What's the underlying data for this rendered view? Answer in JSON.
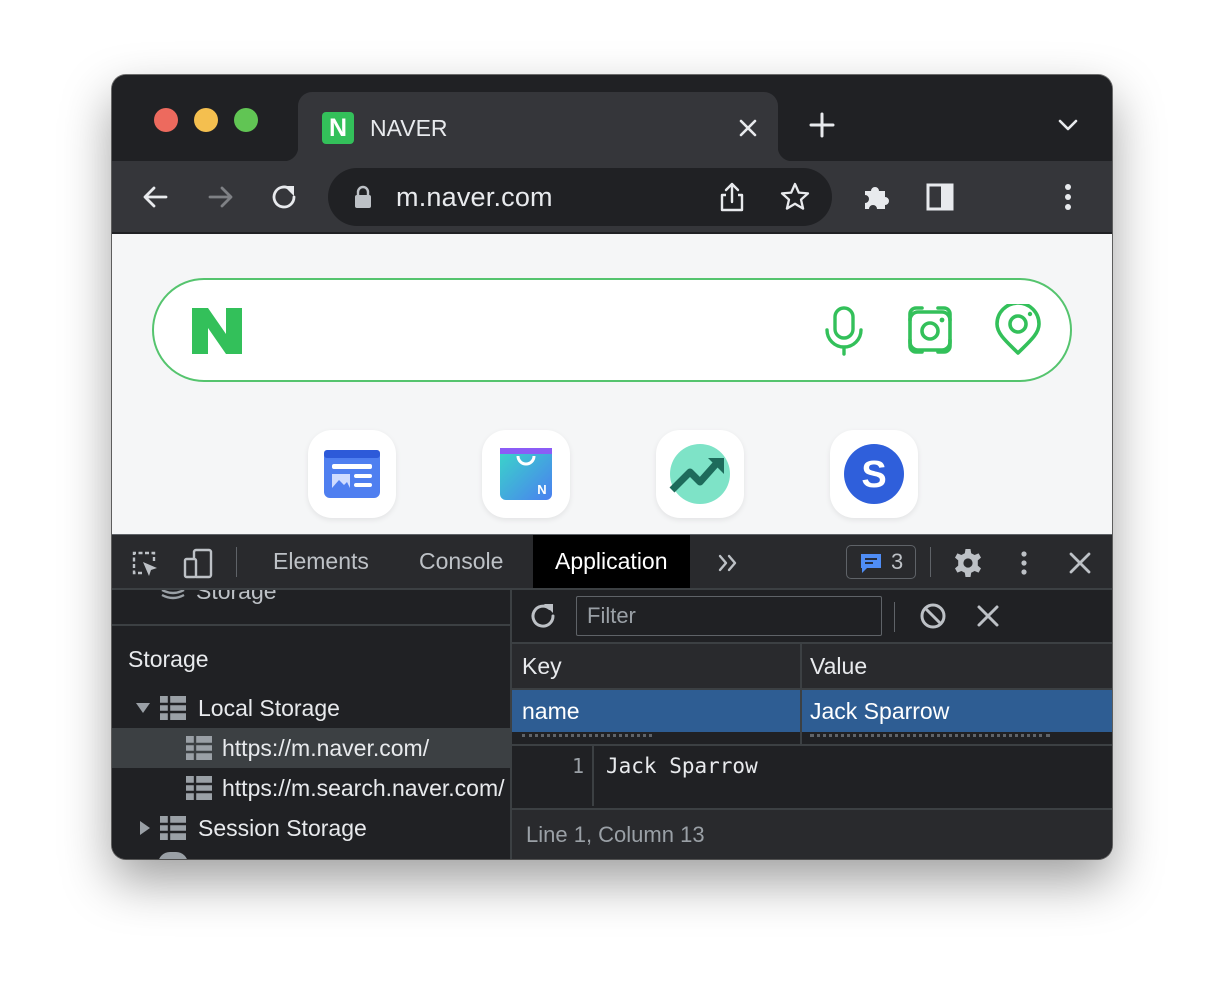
{
  "tab": {
    "title": "NAVER",
    "favicon_letter": "N"
  },
  "toolbar": {
    "url": "m.naver.com"
  },
  "devtools": {
    "tabs": [
      "Elements",
      "Console",
      "Application"
    ],
    "active_tab": "Application",
    "issues_count": "3",
    "sidebar": {
      "partial_label": "Storage",
      "heading": "Storage",
      "local_storage": "Local Storage",
      "origins": [
        "https://m.naver.com/",
        "https://m.search.naver.com/"
      ],
      "session_storage": "Session Storage"
    },
    "filter_placeholder": "Filter",
    "table": {
      "headers": {
        "key": "Key",
        "value": "Value"
      },
      "rows": [
        {
          "key": "name",
          "value": "Jack Sparrow"
        }
      ]
    },
    "editor": {
      "line_number": "1",
      "content": "Jack Sparrow"
    },
    "status": "Line 1, Column 13"
  },
  "colors": {
    "naver_green": "#33c05a",
    "selected_row": "#2e5d93",
    "devtools_bg": "#202124"
  }
}
